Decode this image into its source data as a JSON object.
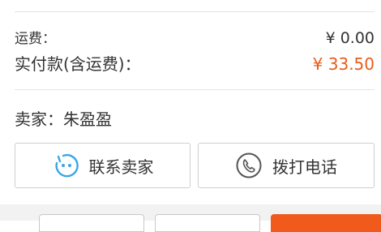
{
  "order": {
    "shipping_label": "运费：",
    "shipping_value": "¥ 0.00",
    "paid_label": "实付款(含运费)：",
    "paid_value": "¥ 33.50"
  },
  "seller": {
    "label": "卖家：朱盈盈"
  },
  "actions": {
    "contact_label": "联系卖家",
    "call_label": "拨打电话"
  },
  "colors": {
    "accent": "#e85d1a",
    "contact_icon": "#3aa6e6"
  },
  "icons": {
    "contact": "chat-face-icon",
    "call": "phone-icon"
  }
}
